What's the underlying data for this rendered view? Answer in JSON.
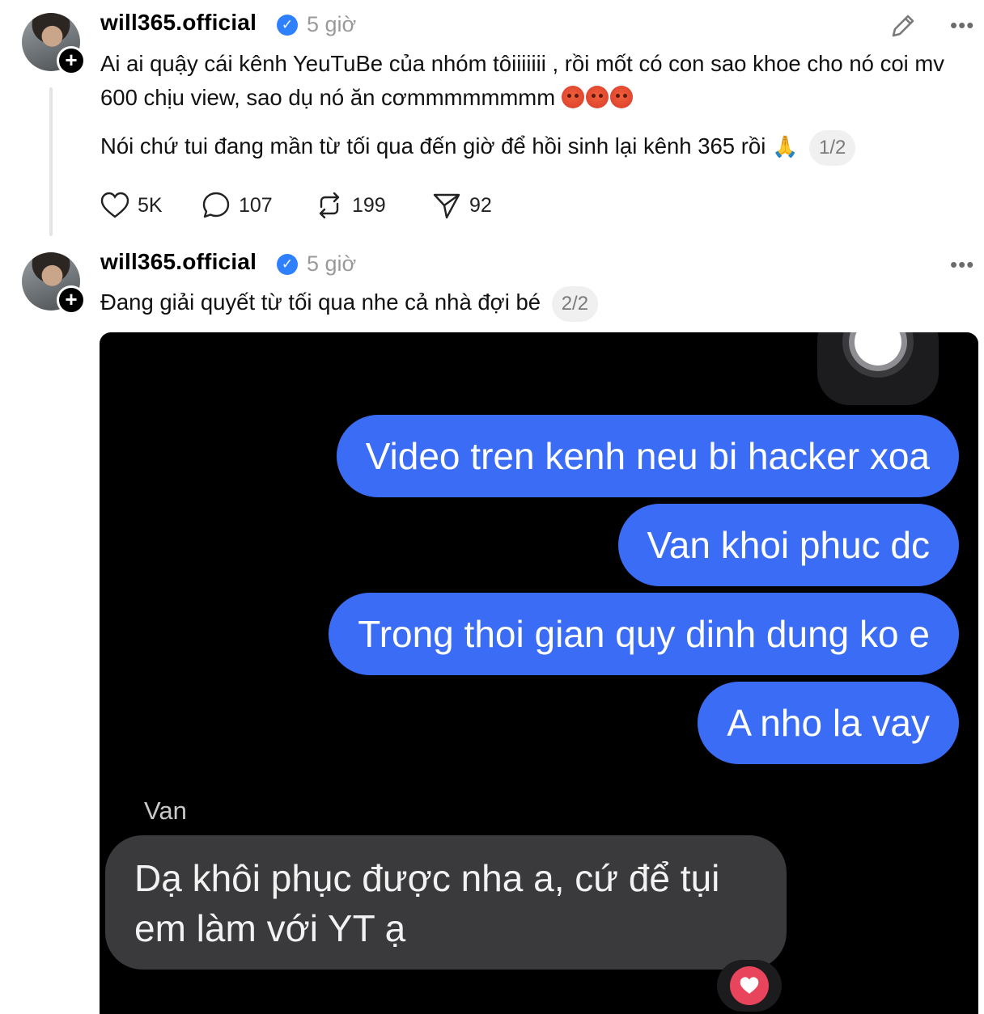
{
  "post1": {
    "username": "will365.official",
    "time": "5 giờ",
    "text": "Ai ai quậy cái kênh YeuTuBe của nhóm tôiiiiiii , rồi mốt có con sao khoe cho nó coi mv 600 chịu view, sao dụ nó ăn cơmmmmmmmm",
    "text2": "Nói chứ tui đang mần từ tối qua đến giờ để hồi sinh lại kênh 365 rồi",
    "pager": "1/2",
    "likes": "5K",
    "comments": "107",
    "reposts": "199",
    "shares": "92",
    "icons": [
      "edit-icon",
      "more-icon",
      "verified-icon",
      "angry-emoji",
      "pray-emoji",
      "heart-icon",
      "comment-icon",
      "repost-icon",
      "share-icon"
    ]
  },
  "post2": {
    "username": "will365.official",
    "time": "5 giờ",
    "text": "Đang giải quyết từ tối qua nhe cả nhà đợi bé",
    "pager": "2/2",
    "image": {
      "outgoing": [
        "Video tren kenh neu bi hacker xoa",
        "Van khoi phuc dc",
        "Trong thoi gian quy dinh dung ko e",
        "A nho la vay"
      ],
      "sender": "Van",
      "incoming": "Dạ khôi phục được nha a, cứ để tụi em làm với YT ạ"
    }
  },
  "colors": {
    "accent": "#3b6cf6",
    "verified": "#2f80ff",
    "muted": "#9a9a9a"
  }
}
